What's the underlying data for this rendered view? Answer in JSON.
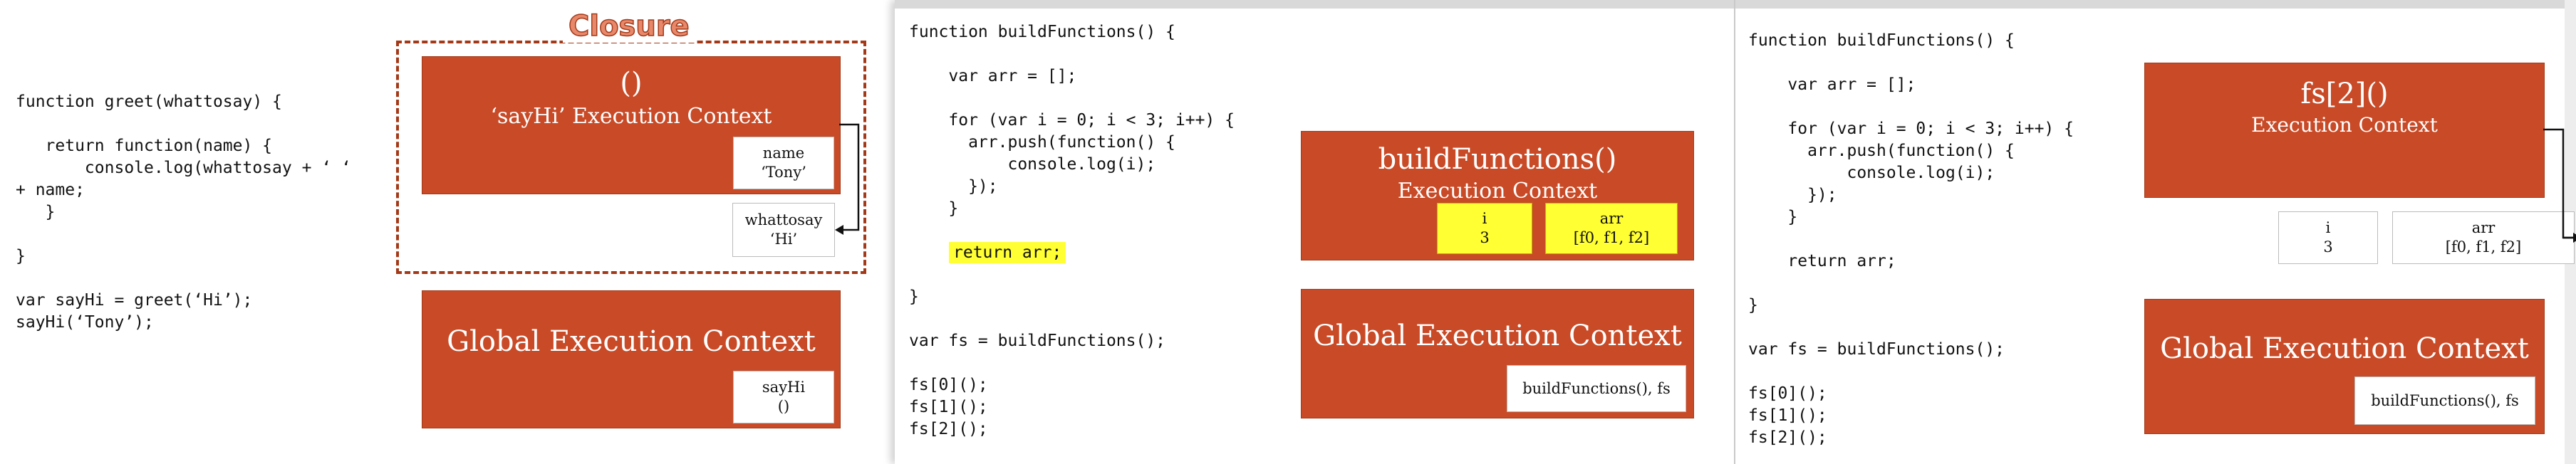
{
  "slide1": {
    "code": "function greet(whattosay) {\n\n   return function(name) {\n       console.log(whattosay + ‘ ‘\n+ name;\n   }\n\n}\n\nvar sayHi = greet(‘Hi’);\nsayHi(‘Tony’);",
    "closure_label": "Closure",
    "inner_context": {
      "title_line1": "()",
      "title_line2": "‘sayHi’ Execution Context",
      "var_name": "name",
      "var_value": "‘Tony’"
    },
    "outer_var": {
      "name": "whattosay",
      "value": "‘Hi’"
    },
    "global_context": {
      "title": "Global Execution Context",
      "var_name": "sayHi",
      "var_value": "()"
    }
  },
  "slide2": {
    "code_top": "function buildFunctions() {\n\n    var arr = [];\n\n    for (var i = 0; i < 3; i++) {\n      arr.push(function() {\n          console.log(i);\n      });\n    }\n",
    "code_return": "return arr;",
    "code_bottom": "}\n\nvar fs = buildFunctions();\n\nfs[0]();\nfs[1]();\nfs[2]();",
    "context": {
      "title_line1": "buildFunctions()",
      "title_line2": "Execution Context",
      "var1_name": "i",
      "var1_value": "3",
      "var2_name": "arr",
      "var2_value": "[f0, f1, f2]"
    },
    "global_context": {
      "title": "Global Execution Context",
      "vars": "buildFunctions(), fs"
    }
  },
  "slide3": {
    "code": "function buildFunctions() {\n\n    var arr = [];\n\n    for (var i = 0; i < 3; i++) {\n      arr.push(function() {\n          console.log(i);\n      });\n    }\n\n    return arr;\n\n}\n\nvar fs = buildFunctions();\n\nfs[0]();\nfs[1]();\nfs[2]();",
    "context": {
      "title_line1": "fs[2]()",
      "title_line2": "Execution Context"
    },
    "var1": {
      "name": "i",
      "value": "3"
    },
    "var2": {
      "name": "arr",
      "value": "[f0, f1, f2]"
    },
    "global_context": {
      "title": "Global Execution Context",
      "vars": "buildFunctions(), fs"
    }
  },
  "colors": {
    "context_fill": "#c84a27",
    "highlight": "#ffff33",
    "closure_outline": "#a33918"
  }
}
